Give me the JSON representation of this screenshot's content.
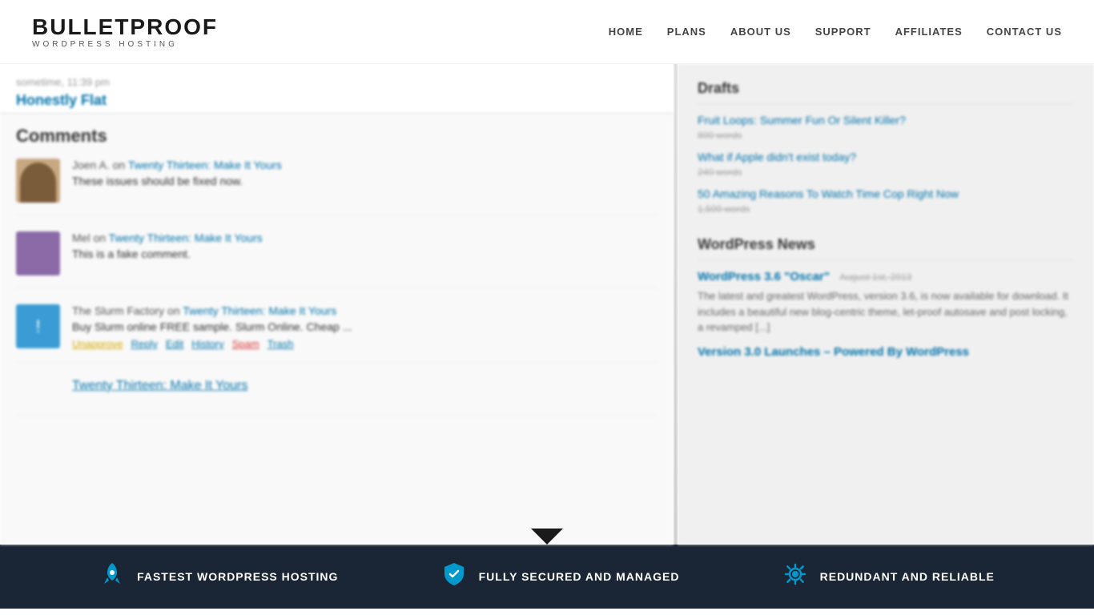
{
  "header": {
    "logo_main": "BULLETPROOF",
    "logo_sub": "WORDPRESS HOSTING",
    "nav": [
      {
        "label": "HOME",
        "href": "#"
      },
      {
        "label": "PLANS",
        "href": "#"
      },
      {
        "label": "ABOUT US",
        "href": "#"
      },
      {
        "label": "SUPPORT",
        "href": "#"
      },
      {
        "label": "AFFILIATES",
        "href": "#"
      },
      {
        "label": "CONTACT US",
        "href": "#"
      }
    ]
  },
  "wp_dashboard": {
    "time": "11:39 pm",
    "theme_link": "Honestly Flat",
    "comments_title": "Comments",
    "comments": [
      {
        "id": 1,
        "avatar_type": "animal",
        "author": "Joen A.",
        "post_link": "Twenty Thirteen: Make It Yours",
        "text": "These issues should be fixed now.",
        "actions": []
      },
      {
        "id": 2,
        "avatar_type": "purple",
        "author": "Mel",
        "post_link": "Twenty Thirteen: Make It Yours",
        "text": "This is a fake comment.",
        "actions": []
      },
      {
        "id": 3,
        "avatar_type": "spam",
        "author": "The Slurm Factory",
        "post_link": "Twenty Thirteen: Make It Yours",
        "text": "Buy Slurm online FREE sample. Slurm Online. Cheap ...",
        "actions": [
          "Unapprove",
          "Reply",
          "Edit",
          "History",
          "Spam",
          "Trash"
        ]
      }
    ],
    "comment_next_post": "Twenty Thirteen: Make It Yours"
  },
  "sidebar": {
    "drafts_title": "Drafts",
    "drafts": [
      {
        "title": "Fruit Loops: Summer Fun Or Silent Killer?",
        "words": "800 words"
      },
      {
        "title": "What if Apple didn't exist today?",
        "words": "240 words"
      },
      {
        "title": "50 Amazing Reasons To Watch Time Cop Right Now",
        "words": "1,500 words"
      }
    ],
    "news_title": "WordPress News",
    "news_items": [
      {
        "title": "WordPress 3.6 \"Oscar\"",
        "date": "August 1st, 2013",
        "excerpt": "The latest and greatest WordPress, version 3.6, is now available for download. It includes a beautiful new blog-centric theme, let-proof autosave and post locking, a revamped [...]"
      },
      {
        "title": "Version 3.0 Launches – Powered By WordPress",
        "date": "",
        "excerpt": ""
      }
    ]
  },
  "footer": {
    "features": [
      {
        "icon": "rocket",
        "text": "FASTEST WORDPRESS HOSTING"
      },
      {
        "icon": "shield",
        "text": "FULLY SECURED AND MANAGED"
      },
      {
        "icon": "gear",
        "text": "REDUNDANT AND RELIABLE"
      }
    ]
  }
}
